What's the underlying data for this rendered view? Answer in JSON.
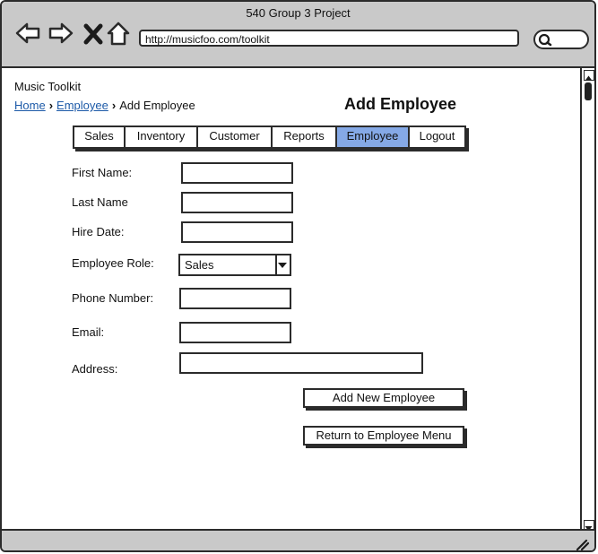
{
  "window": {
    "title": "540 Group 3 Project"
  },
  "browser": {
    "url": "http://musicfoo.com/toolkit"
  },
  "app": {
    "name": "Music Toolkit"
  },
  "breadcrumb": {
    "home": "Home",
    "employee": "Employee",
    "current": "Add Employee"
  },
  "page": {
    "title": "Add Employee"
  },
  "tabs": [
    {
      "label": "Sales"
    },
    {
      "label": "Inventory"
    },
    {
      "label": "Customer"
    },
    {
      "label": "Reports"
    },
    {
      "label": "Employee"
    },
    {
      "label": "Logout"
    }
  ],
  "form": {
    "first_name_label": "First Name:",
    "last_name_label": "Last Name",
    "hire_date_label": "Hire Date:",
    "role_label": "Employee Role:",
    "role_value": "Sales",
    "phone_label": "Phone Number:",
    "email_label": "Email:",
    "address_label": "Address:"
  },
  "buttons": {
    "add": "Add New Employee",
    "return": "Return to Employee Menu"
  },
  "colors": {
    "active_tab": "#85a9e6",
    "chrome": "#c9c9c9",
    "link": "#1d5aa8"
  }
}
